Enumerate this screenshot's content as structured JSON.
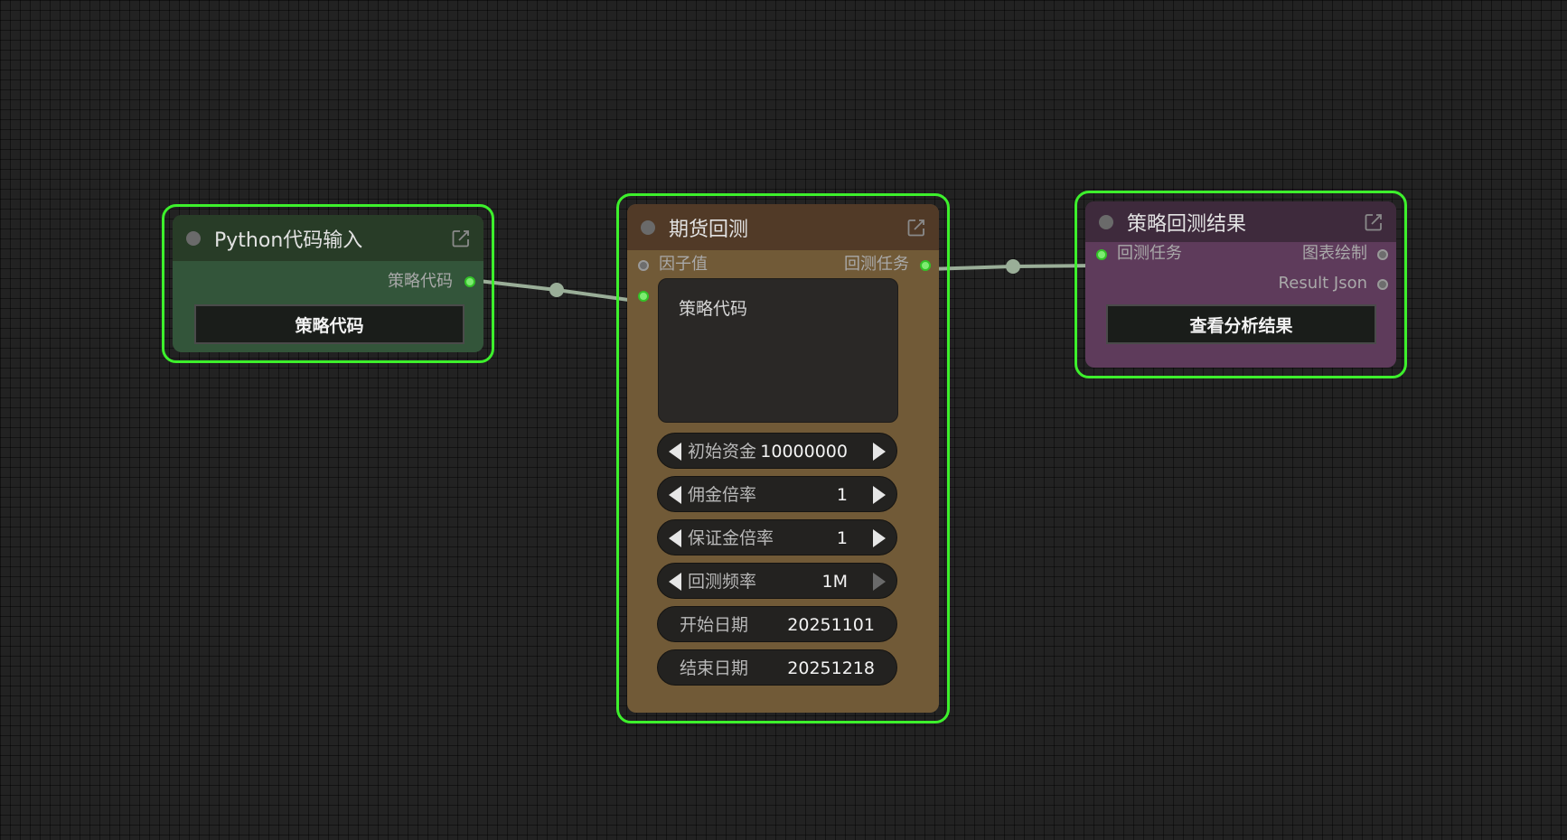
{
  "colors": {
    "selection_border": "#3df02c",
    "link": "#9aae98",
    "python_title_bg": "#283c27",
    "python_body_bg": "#33553a",
    "futures_title_bg": "#513a27",
    "futures_body_bg": "#715a37",
    "result_title_bg": "#3e2a3c",
    "result_body_bg": "#5e3b5b"
  },
  "python_node": {
    "title": "Python代码输入",
    "output_label": "策略代码",
    "button_label": "策略代码"
  },
  "futures_node": {
    "title": "期货回测",
    "input_factor_label": "因子值",
    "output_task_label": "回测任务",
    "code_placeholder": "策略代码",
    "widgets": {
      "initial_capital": {
        "label": "初始资金",
        "value": "10000000"
      },
      "commission_ratio": {
        "label": "佣金倍率",
        "value": "1"
      },
      "margin_ratio": {
        "label": "保证金倍率",
        "value": "1"
      },
      "backtest_freq": {
        "label": "回测频率",
        "value": "1M"
      },
      "start_date": {
        "label": "开始日期",
        "value": "20251101"
      },
      "end_date": {
        "label": "结束日期",
        "value": "20251218"
      }
    }
  },
  "result_node": {
    "title": "策略回测结果",
    "input_task_label": "回测任务",
    "output_chart_label": "图表绘制",
    "output_json_label": "Result Json",
    "button_label": "查看分析结果"
  }
}
